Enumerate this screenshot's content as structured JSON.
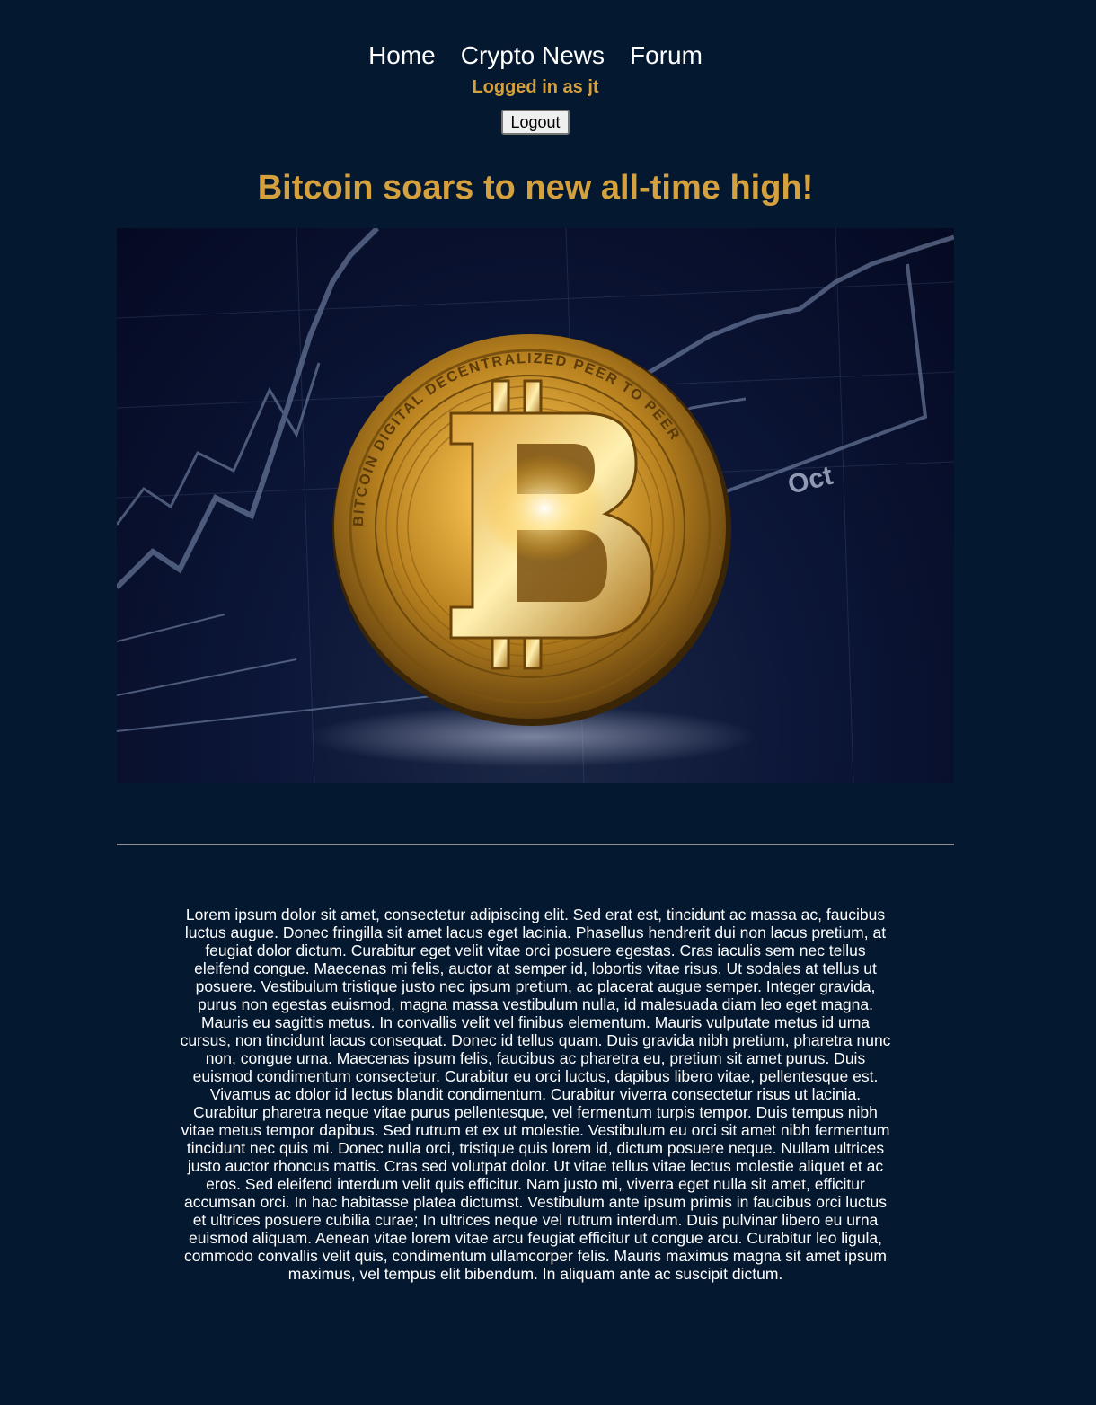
{
  "nav": {
    "items": [
      {
        "label": "Home"
      },
      {
        "label": "Crypto News"
      },
      {
        "label": "Forum"
      }
    ]
  },
  "auth": {
    "status": "Logged in as jt",
    "logout_label": "Logout"
  },
  "article": {
    "title": "Bitcoin soars to new all-time high!",
    "image": {
      "chart_label": "Oct",
      "coin_ring_text": "BITCOIN DIGITAL DECENTRALIZED PEER TO PEER"
    },
    "body": "Lorem ipsum dolor sit amet, consectetur adipiscing elit. Sed erat est, tincidunt ac massa ac, faucibus luctus augue. Donec fringilla sit amet lacus eget lacinia. Phasellus hendrerit dui non lacus pretium, at feugiat dolor dictum. Curabitur eget velit vitae orci posuere egestas. Cras iaculis sem nec tellus eleifend congue. Maecenas mi felis, auctor at semper id, lobortis vitae risus. Ut sodales at tellus ut posuere. Vestibulum tristique justo nec ipsum pretium, ac placerat augue semper. Integer gravida, purus non egestas euismod, magna massa vestibulum nulla, id malesuada diam leo eget magna. Mauris eu sagittis metus. In convallis velit vel finibus elementum. Mauris vulputate metus id urna cursus, non tincidunt lacus consequat. Donec id tellus quam. Duis gravida nibh pretium, pharetra nunc non, congue urna. Maecenas ipsum felis, faucibus ac pharetra eu, pretium sit amet purus. Duis euismod condimentum consectetur. Curabitur eu orci luctus, dapibus libero vitae, pellentesque est. Vivamus ac dolor id lectus blandit condimentum. Curabitur viverra consectetur risus ut lacinia. Curabitur pharetra neque vitae purus pellentesque, vel fermentum turpis tempor. Duis tempus nibh vitae metus tempor dapibus. Sed rutrum et ex ut molestie. Vestibulum eu orci sit amet nibh fermentum tincidunt nec quis mi. Donec nulla orci, tristique quis lorem id, dictum posuere neque. Nullam ultrices justo auctor rhoncus mattis. Cras sed volutpat dolor. Ut vitae tellus vitae lectus molestie aliquet et ac eros. Sed eleifend interdum velit quis efficitur. Nam justo mi, viverra eget nulla sit amet, efficitur accumsan orci. In hac habitasse platea dictumst. Vestibulum ante ipsum primis in faucibus orci luctus et ultrices posuere cubilia curae; In ultrices neque vel rutrum interdum. Duis pulvinar libero eu urna euismod aliquam. Aenean vitae lorem vitae arcu feugiat efficitur ut congue arcu. Curabitur leo ligula, commodo convallis velit quis, condimentum ullamcorper felis. Mauris maximus magna sit amet ipsum maximus, vel tempus elit bibendum. In aliquam ante ac suscipit dictum."
  },
  "colors": {
    "background": "#041830",
    "accent_gold": "#d4a13e",
    "text": "#ffffff",
    "divider": "#8a8f99"
  }
}
